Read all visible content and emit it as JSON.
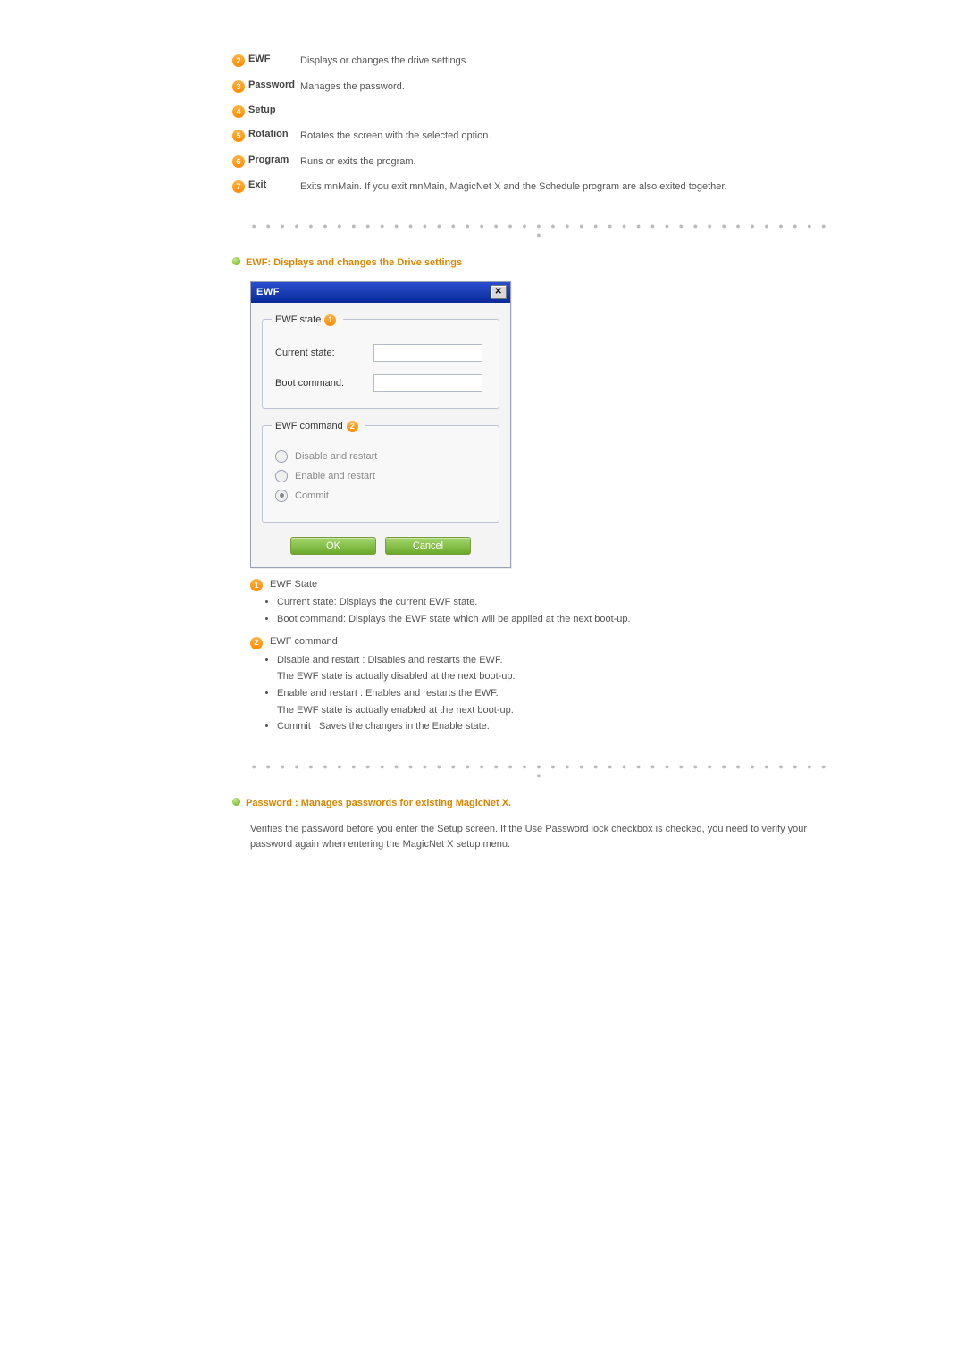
{
  "menu_items": [
    {
      "num": "2",
      "label": "EWF",
      "desc": "Displays or changes the drive settings."
    },
    {
      "num": "3",
      "label": "Password",
      "desc": "Manages the password."
    },
    {
      "num": "4",
      "label": "Setup",
      "desc": ""
    },
    {
      "num": "5",
      "label": "Rotation",
      "desc": "Rotates the screen with the selected option."
    },
    {
      "num": "6",
      "label": "Program",
      "desc": "Runs or exits the program."
    },
    {
      "num": "7",
      "label": "Exit",
      "desc": "Exits mnMain. If you exit mnMain, MagicNet X and the Schedule program are also exited together."
    }
  ],
  "ewf_heading": "EWF: Displays and changes the Drive settings",
  "dialog": {
    "title": "EWF",
    "group1": {
      "legend": "EWF state",
      "badge": "1",
      "row1_label": "Current state:",
      "row1_value": "",
      "row2_label": "Boot command:",
      "row2_value": ""
    },
    "group2": {
      "legend": "EWF command",
      "badge": "2",
      "opt1": "Disable and restart",
      "opt2": "Enable and restart",
      "opt3": "Commit"
    },
    "ok": "OK",
    "cancel": "Cancel"
  },
  "legend1": {
    "badge": "1",
    "title": "EWF State",
    "items": [
      "Current state: Displays the current EWF state.",
      "Boot command: Displays the EWF state which will be applied at the next boot-up."
    ]
  },
  "legend2": {
    "badge": "2",
    "title": "EWF command",
    "items": [
      "Disable and restart : Disables and restarts the EWF.",
      "The EWF state is actually disabled at the next boot-up.",
      "Enable and restart : Enables and restarts the EWF.",
      "The EWF state is actually enabled at the next boot-up.",
      "Commit : Saves the changes in the Enable state."
    ]
  },
  "pwd_heading": "Password : Manages passwords for existing MagicNet X.",
  "pwd_body": "Verifies the password before you enter the Setup screen. If the Use Password lock checkbox is checked, you need to verify your password again when entering the MagicNet X setup menu."
}
